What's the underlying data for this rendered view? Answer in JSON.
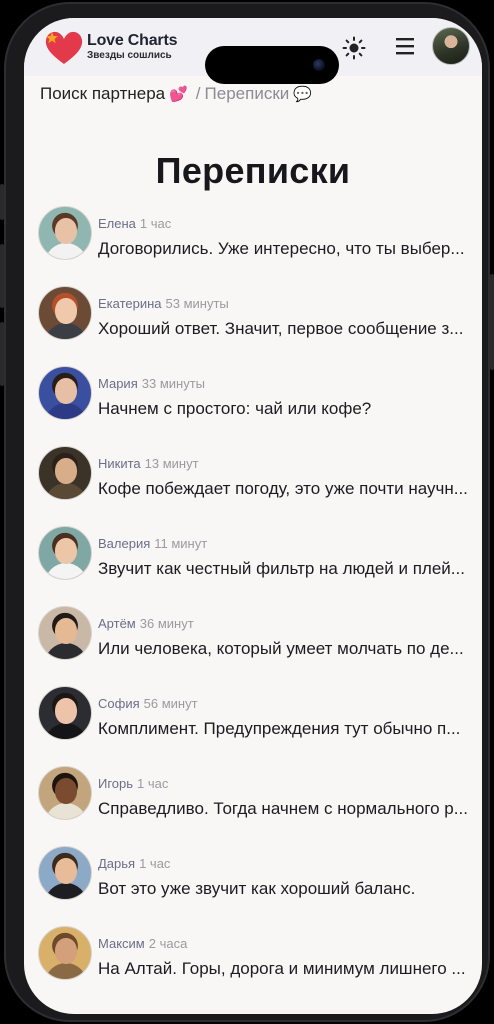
{
  "brand": {
    "title": "Love Charts",
    "subtitle": "Звезды сошлись"
  },
  "header": {
    "theme_icon": "sun-icon",
    "menu_icon": "hamburger-menu-icon"
  },
  "breadcrumb": {
    "parent": "Поиск партнера",
    "parent_icon": "💕",
    "separator": "/",
    "current": "Переписки",
    "current_icon": "💬"
  },
  "page": {
    "title": "Переписки"
  },
  "chats": [
    {
      "name": "Елена",
      "time": "1 час",
      "message": "Договорились. Уже интересно, что ты выбер...",
      "avatar": {
        "bg": "#8fb6b0",
        "skin": "#e8c2a6",
        "hair": "#5a3a24",
        "cloth": "#f2f2f2"
      }
    },
    {
      "name": "Екатерина",
      "time": "53 минуты",
      "message": "Хороший ответ. Значит, первое сообщение з...",
      "avatar": {
        "bg": "#6b4a36",
        "skin": "#f0c9ab",
        "hair": "#b5502a",
        "cloth": "#3b3e45"
      }
    },
    {
      "name": "Мария",
      "time": "33 минуты",
      "message": "Начнем с простого: чай или кофе?",
      "avatar": {
        "bg": "#3a4fa0",
        "skin": "#e6bfa4",
        "hair": "#2a1d18",
        "cloth": "#2d3a86"
      }
    },
    {
      "name": "Никита",
      "time": "13 минут",
      "message": "Кофе побеждает погоду, это уже почти научн...",
      "avatar": {
        "bg": "#3b3328",
        "skin": "#d8ad8a",
        "hair": "#2c211a",
        "cloth": "#5a4a35"
      }
    },
    {
      "name": "Валерия",
      "time": "11 минут",
      "message": "Звучит как честный фильтр на людей и плей...",
      "avatar": {
        "bg": "#7fa8a4",
        "skin": "#edc6a8",
        "hair": "#4a2f20",
        "cloth": "#f4f4f4"
      }
    },
    {
      "name": "Артём",
      "time": "36 минут",
      "message": "Или человека, который умеет молчать по де...",
      "avatar": {
        "bg": "#c9b8a6",
        "skin": "#e6b995",
        "hair": "#1f1a17",
        "cloth": "#2b2b30"
      }
    },
    {
      "name": "София",
      "time": "56 минут",
      "message": "Комплимент. Предупреждения тут обычно п...",
      "avatar": {
        "bg": "#2c2c33",
        "skin": "#edc4aa",
        "hair": "#1c1714",
        "cloth": "#151518"
      }
    },
    {
      "name": "Игорь",
      "time": "1 час",
      "message": "Справедливо. Тогда начнем с нормального р...",
      "avatar": {
        "bg": "#c2a57c",
        "skin": "#7a4b2e",
        "hair": "#1d1410",
        "cloth": "#e9e3d6"
      }
    },
    {
      "name": "Дарья",
      "time": "1 час",
      "message": "Вот это уже звучит как хороший баланс.",
      "avatar": {
        "bg": "#8ca9c8",
        "skin": "#e9bc99",
        "hair": "#3d2a1f",
        "cloth": "#1e1e22"
      }
    },
    {
      "name": "Максим",
      "time": "2 часа",
      "message": "На Алтай. Горы, дорога и минимум лишнего ...",
      "avatar": {
        "bg": "#d9b06a",
        "skin": "#d3a07b",
        "hair": "#6b4a2a",
        "cloth": "#8a6a45"
      }
    }
  ]
}
